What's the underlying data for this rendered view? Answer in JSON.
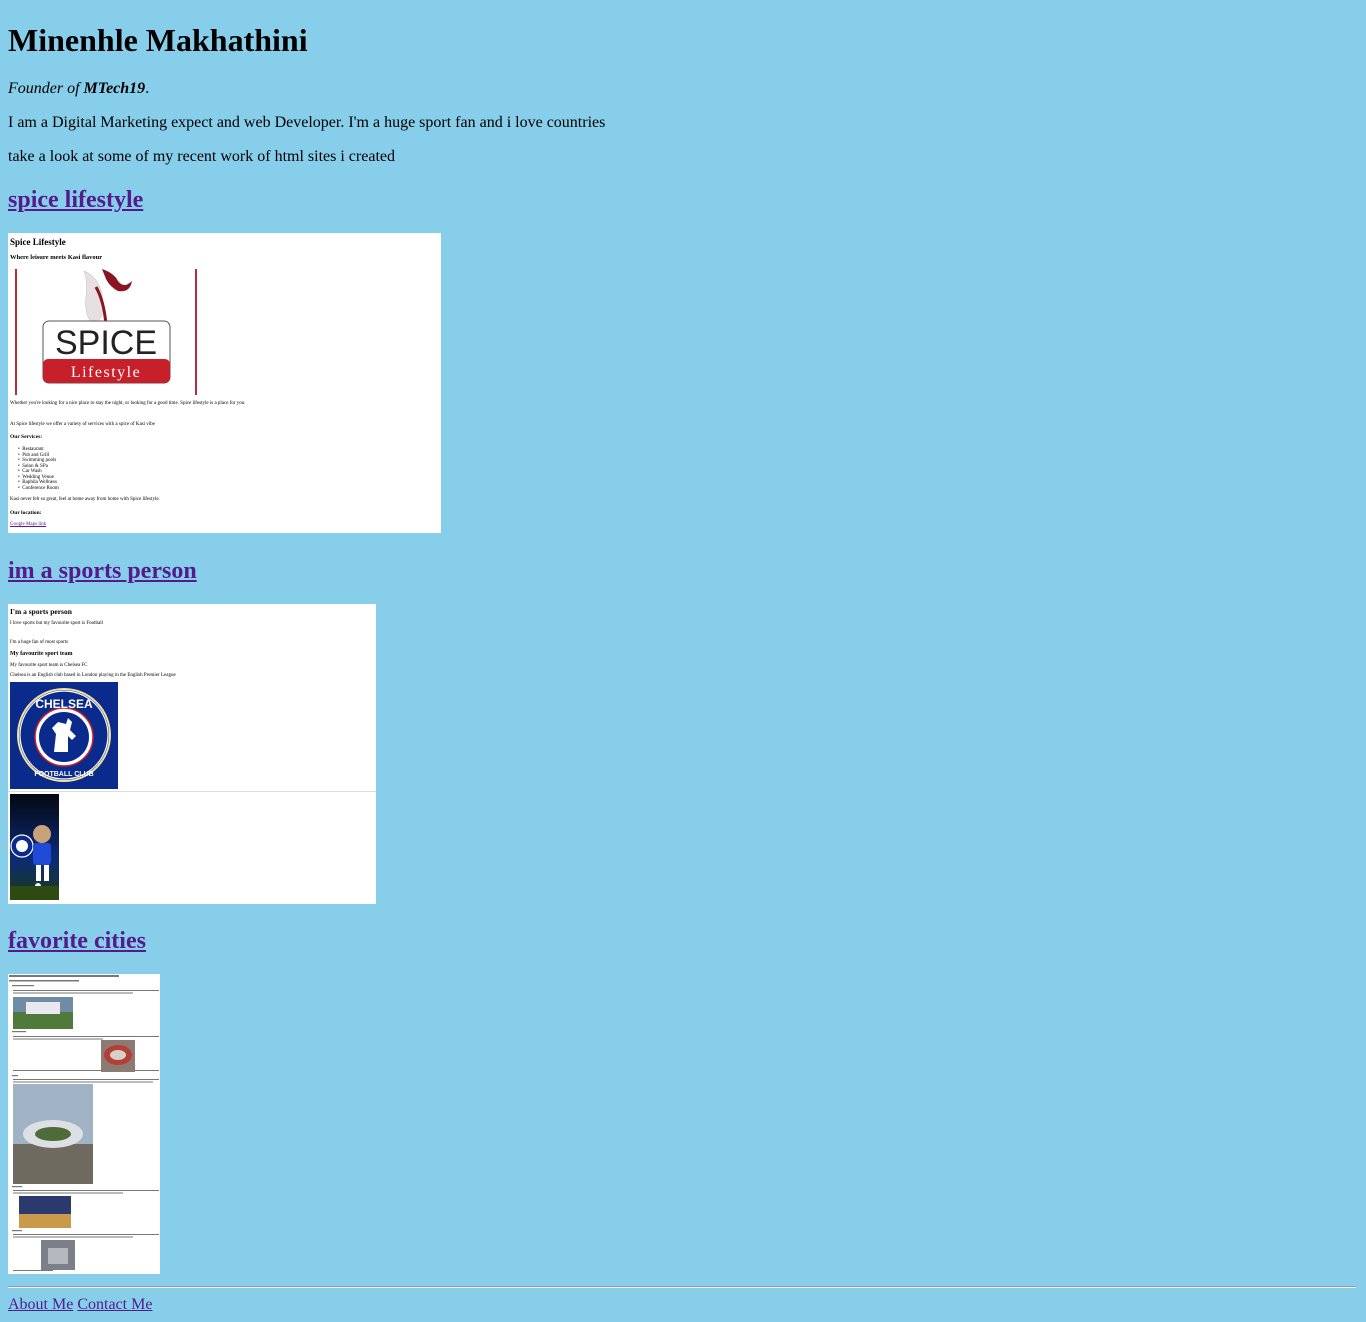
{
  "header": {
    "name": "Minenhle Makhathini",
    "founder_prefix": "Founder of ",
    "company": "MTech19",
    "founder_suffix": ".",
    "bio": "I am a Digital Marketing expect and web Developer. I'm a huge sport fan and i love countries",
    "intro": "take a look at some of my recent work of html sites i created"
  },
  "projects": [
    {
      "link_label": "spice lifestyle",
      "preview": {
        "title": "Spice Lifestyle",
        "subtitle": "Where leisure meets Kasi flavour",
        "logo_word": "SPICE",
        "logo_sub": "Lifestyle",
        "para1": "Whether you're looking for a nice place to stay the night, or looking for a good time. Spice lifestyle is a place for you.",
        "para2": "At Spice lifestyle we offer a variety of services with a spice of Kasi vibe",
        "services_heading": "Our Services:",
        "services": [
          "Restaurant",
          "Pub and Grill",
          "Swimming pools",
          "Salon & SPa",
          "Car Wash",
          "Wedding Venue",
          "Baphila Wellness",
          "Conference Room"
        ],
        "para3": "Kasi never felt so great, feel at home away from home with Spice lifestyle.",
        "location_heading": "Our location:",
        "location_link": "Google Maps link"
      }
    },
    {
      "link_label": "im a sports person",
      "preview": {
        "title": "I'm a sports person",
        "line1": "I love sports but my favourite sport is Football",
        "line2": "I'm a huge fan of most sports",
        "team_heading": "My favourite sport team",
        "line3": "My favourite sport team is Chelsea FC",
        "line4": "Chelsea is an English club based in London playing in the English Premier League",
        "badge_top": "CHELSEA",
        "badge_bottom": "FOOTBALL CLUB"
      }
    },
    {
      "link_label": "favorite cities",
      "preview": {}
    }
  ],
  "footer": {
    "about_label": "About Me",
    "contact_label": "Contact Me"
  },
  "colors": {
    "background": "#87ceea",
    "link": "#551a8b",
    "spice_red": "#c8202a",
    "chelsea_blue": "#0a2a8c"
  }
}
